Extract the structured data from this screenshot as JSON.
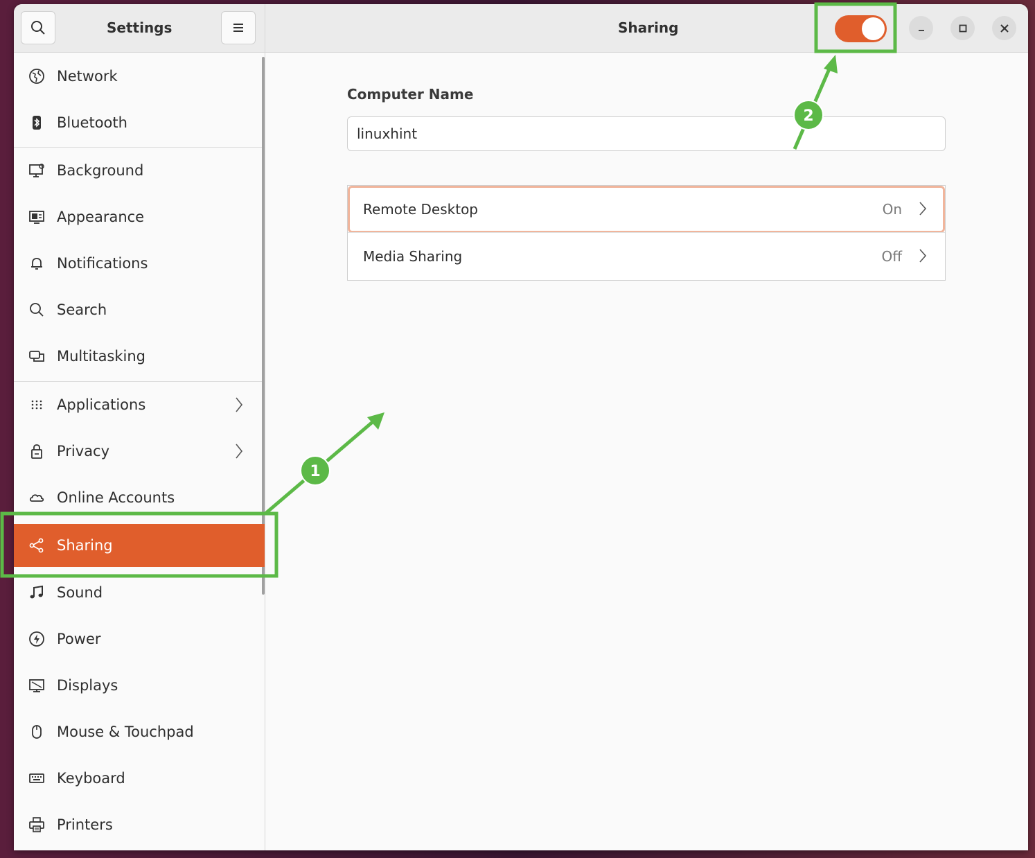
{
  "header": {
    "sidebar_title": "Settings",
    "page_title": "Sharing",
    "toggle_state": "on"
  },
  "sidebar": {
    "items": [
      {
        "label": "Network",
        "icon": "network-icon"
      },
      {
        "label": "Bluetooth",
        "icon": "bluetooth-icon"
      },
      {
        "label": "Background",
        "icon": "background-icon"
      },
      {
        "label": "Appearance",
        "icon": "appearance-icon"
      },
      {
        "label": "Notifications",
        "icon": "bell-icon"
      },
      {
        "label": "Search",
        "icon": "search-icon"
      },
      {
        "label": "Multitasking",
        "icon": "multitasking-icon"
      },
      {
        "label": "Applications",
        "icon": "apps-grid-icon",
        "chevron": true
      },
      {
        "label": "Privacy",
        "icon": "lock-icon",
        "chevron": true
      },
      {
        "label": "Online Accounts",
        "icon": "cloud-icon"
      },
      {
        "label": "Sharing",
        "icon": "share-icon",
        "active": true
      },
      {
        "label": "Sound",
        "icon": "music-note-icon"
      },
      {
        "label": "Power",
        "icon": "power-icon"
      },
      {
        "label": "Displays",
        "icon": "display-icon"
      },
      {
        "label": "Mouse & Touchpad",
        "icon": "mouse-icon"
      },
      {
        "label": "Keyboard",
        "icon": "keyboard-icon"
      },
      {
        "label": "Printers",
        "icon": "printer-icon"
      }
    ]
  },
  "content": {
    "computer_name_label": "Computer Name",
    "computer_name_value": "linuxhint",
    "rows": [
      {
        "label": "Remote Desktop",
        "value": "On"
      },
      {
        "label": "Media Sharing",
        "value": "Off"
      }
    ]
  },
  "annotations": {
    "badge_1": "1",
    "badge_2": "2",
    "color": "#5cb947"
  },
  "colors": {
    "accent": "#e05e2c",
    "focus_ring": "#f0b59c"
  }
}
